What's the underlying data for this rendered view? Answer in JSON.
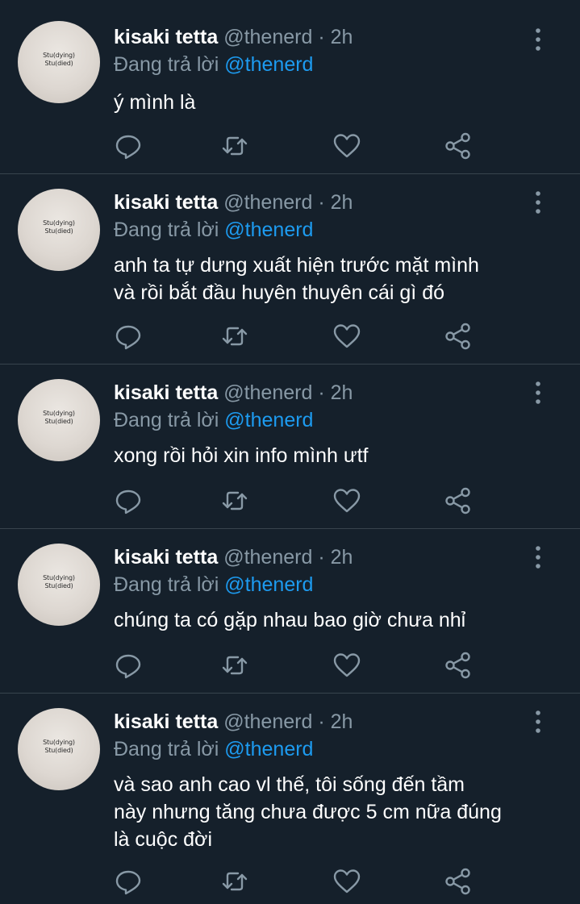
{
  "theme": {
    "background": "#15202b",
    "divider": "#38444d",
    "muted": "#8899a6",
    "link": "#1d9bf0",
    "text": "#ffffff"
  },
  "tweets": [
    {
      "name": "kisaki tetta",
      "handle": "@thenerd",
      "separator": "·",
      "time": "2h",
      "reply_label": "Đang trả lời",
      "reply_to": "@thenerd",
      "avatar_text": [
        "Stu(dying)",
        "Stu(died)"
      ],
      "lines": [
        "ý mình là"
      ],
      "icons": [
        "more-icon",
        "reply-icon",
        "retweet-icon",
        "like-icon",
        "share-icon"
      ]
    },
    {
      "name": "kisaki tetta",
      "handle": "@thenerd",
      "separator": "·",
      "time": "2h",
      "reply_label": "Đang trả lời",
      "reply_to": "@thenerd",
      "avatar_text": [
        "Stu(dying)",
        "Stu(died)"
      ],
      "lines": [
        "anh ta tự dưng xuất hiện trước mặt mình",
        "và rồi bắt đầu huyên thuyên cái gì đó"
      ],
      "icons": [
        "more-icon",
        "reply-icon",
        "retweet-icon",
        "like-icon",
        "share-icon"
      ]
    },
    {
      "name": "kisaki tetta",
      "handle": "@thenerd",
      "separator": "·",
      "time": "2h",
      "reply_label": "Đang trả lời",
      "reply_to": "@thenerd",
      "avatar_text": [
        "Stu(dying)",
        "Stu(died)"
      ],
      "lines": [
        "xong rồi hỏi xin info mình ưtf"
      ],
      "icons": [
        "more-icon",
        "reply-icon",
        "retweet-icon",
        "like-icon",
        "share-icon"
      ]
    },
    {
      "name": "kisaki tetta",
      "handle": "@thenerd",
      "separator": "·",
      "time": "2h",
      "reply_label": "Đang trả lời",
      "reply_to": "@thenerd",
      "avatar_text": [
        "Stu(dying)",
        "Stu(died)"
      ],
      "lines": [
        "chúng ta có gặp nhau bao giờ chưa nhỉ"
      ],
      "icons": [
        "more-icon",
        "reply-icon",
        "retweet-icon",
        "like-icon",
        "share-icon"
      ]
    },
    {
      "name": "kisaki tetta",
      "handle": "@thenerd",
      "separator": "·",
      "time": "2h",
      "reply_label": "Đang trả lời",
      "reply_to": "@thenerd",
      "avatar_text": [
        "Stu(dying)",
        "Stu(died)"
      ],
      "lines": [
        "và sao anh cao vl thế, tôi sống đến tầm",
        "này nhưng tăng chưa được 5 cm nữa đúng",
        "là cuộc đời"
      ],
      "icons": [
        "more-icon",
        "reply-icon",
        "retweet-icon",
        "like-icon",
        "share-icon"
      ]
    }
  ]
}
